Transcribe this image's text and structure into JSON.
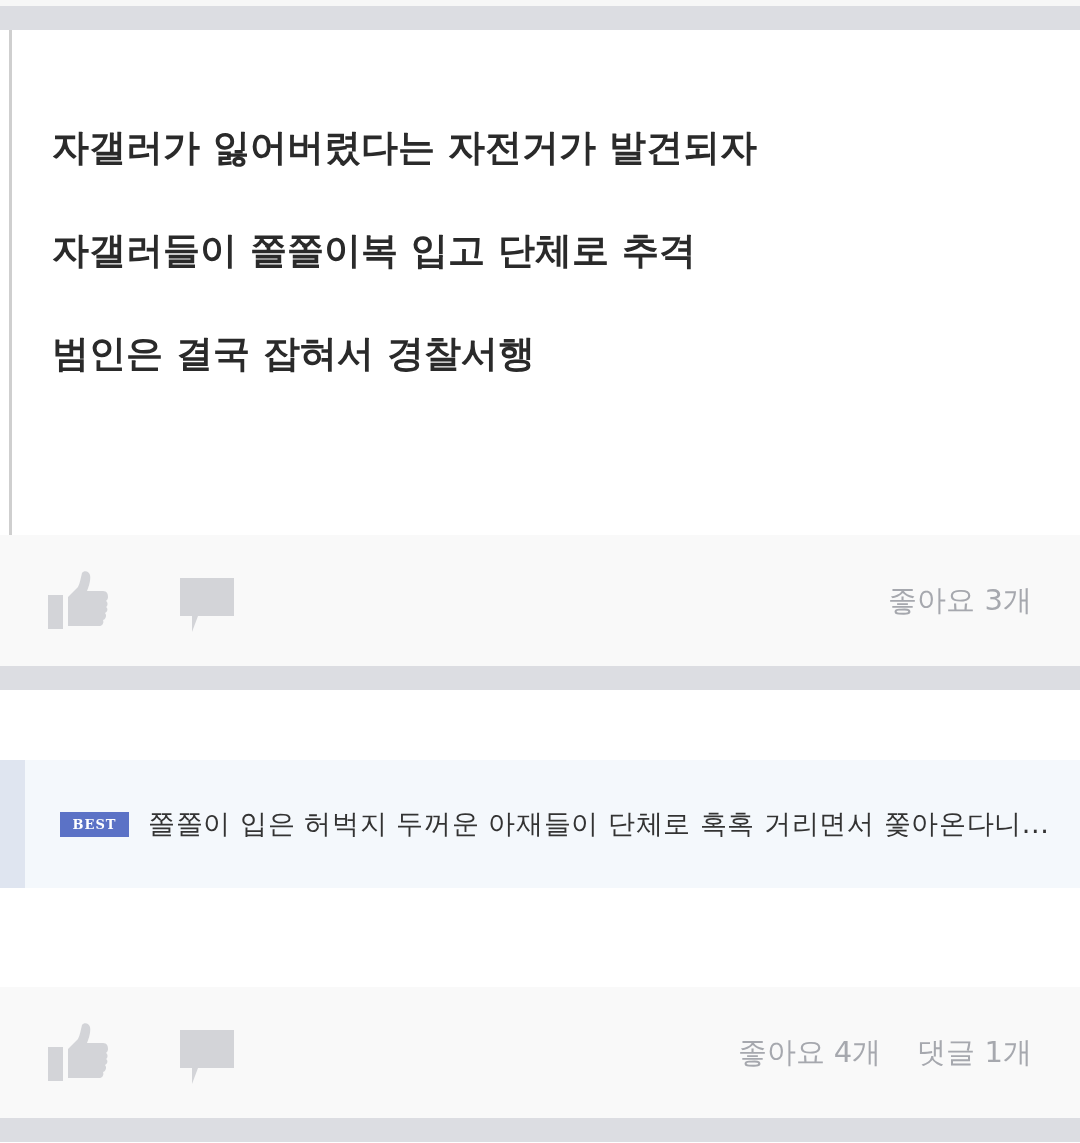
{
  "post": {
    "lines": [
      "자갤러가 잃어버렸다는 자전거가 발견되자",
      "자갤러들이 쫄쫄이복 입고 단체로 추격",
      "범인은 결국 잡혀서 경찰서행"
    ]
  },
  "post_actions": {
    "counts": [
      "좋아요 3개"
    ]
  },
  "comment": {
    "badge": "BEST",
    "text": "쫄쫄이 입은 허벅지 두꺼운 아재들이 단체로 혹혹 거리면서 쫓아온다니..."
  },
  "comment_actions": {
    "counts": [
      "좋아요 4개",
      "댓글 1개"
    ]
  }
}
